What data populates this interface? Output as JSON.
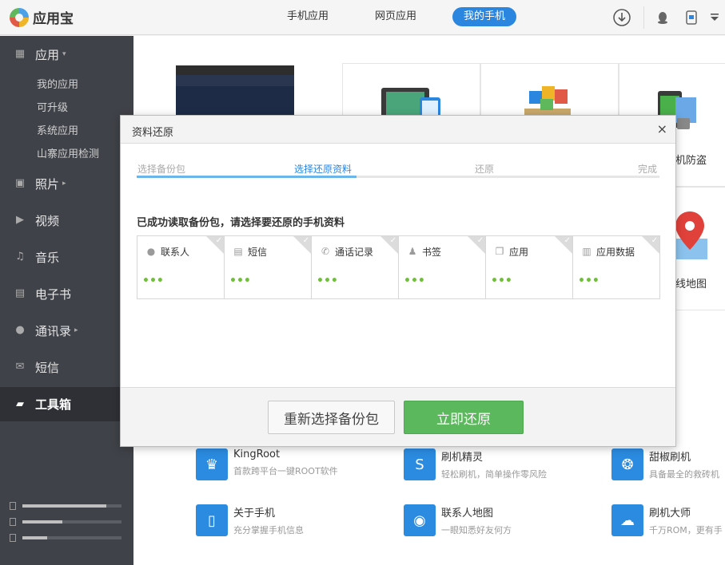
{
  "app": {
    "name": "应用宝"
  },
  "header": {
    "tabs": [
      {
        "label": "手机应用",
        "active": false
      },
      {
        "label": "网页应用",
        "active": false
      },
      {
        "label": "我的手机",
        "active": true
      }
    ]
  },
  "sidebar": {
    "items": [
      {
        "label": "应用",
        "icon": "apps-icon",
        "arrow": "▾"
      },
      {
        "label": "照片",
        "icon": "photo-icon",
        "arrow": "▸"
      },
      {
        "label": "视频",
        "icon": "video-icon",
        "arrow": ""
      },
      {
        "label": "音乐",
        "icon": "music-icon",
        "arrow": ""
      },
      {
        "label": "电子书",
        "icon": "ebook-icon",
        "arrow": ""
      },
      {
        "label": "通讯录",
        "icon": "contacts-icon",
        "arrow": "▸"
      },
      {
        "label": "短信",
        "icon": "sms-icon",
        "arrow": ""
      },
      {
        "label": "工具箱",
        "icon": "toolbox-icon",
        "arrow": "",
        "active": true
      }
    ],
    "sub_items": [
      "我的应用",
      "可升级",
      "系统应用",
      "山寨应用检测"
    ],
    "storage": [
      {
        "icon": "phone-storage-icon",
        "fill": 0.85
      },
      {
        "icon": "sdcard-storage-icon",
        "fill": 0.4
      },
      {
        "icon": "extra-storage-icon",
        "fill": 0.25
      }
    ]
  },
  "background": {
    "tile_labels": [
      "机防盗",
      "线地图"
    ],
    "tools": [
      {
        "name": "KingRoot",
        "desc": "首款跨平台一键ROOT软件",
        "icon": "crown-icon"
      },
      {
        "name": "刷机精灵",
        "desc": "轻松刷机，简单操作零风险",
        "icon": "shield-s-icon"
      },
      {
        "name": "甜椒刷机",
        "desc": "具备最全的救砖机",
        "icon": "pepper-icon"
      },
      {
        "name": "关于手机",
        "desc": "充分掌握手机信息",
        "icon": "phone-info-icon"
      },
      {
        "name": "联系人地图",
        "desc": "一眼知悉好友何方",
        "icon": "map-pin-icon"
      },
      {
        "name": "刷机大师",
        "desc": "千万ROM，更有手",
        "icon": "cloud-icon"
      }
    ]
  },
  "modal": {
    "title": "资料还原",
    "close": "×",
    "steps": [
      {
        "label": "选择备份包",
        "current": false
      },
      {
        "label": "选择还原资料",
        "current": true
      },
      {
        "label": "还原",
        "current": false
      },
      {
        "label": "完成",
        "current": false
      }
    ],
    "progress": 0.42,
    "prompt": "已成功读取备份包，请选择要还原的手机资料",
    "cards": [
      {
        "label": "联系人",
        "icon": "person-icon",
        "dots": "•••"
      },
      {
        "label": "短信",
        "icon": "message-icon",
        "dots": "•••"
      },
      {
        "label": "通话记录",
        "icon": "phone-icon",
        "dots": "•••"
      },
      {
        "label": "书签",
        "icon": "bookmark-icon",
        "dots": "•••"
      },
      {
        "label": "应用",
        "icon": "app-icon",
        "dots": "•••"
      },
      {
        "label": "应用数据",
        "icon": "chart-icon",
        "dots": "•••"
      }
    ],
    "buttons": {
      "reselect": "重新选择备份包",
      "restore": "立即还原"
    }
  }
}
